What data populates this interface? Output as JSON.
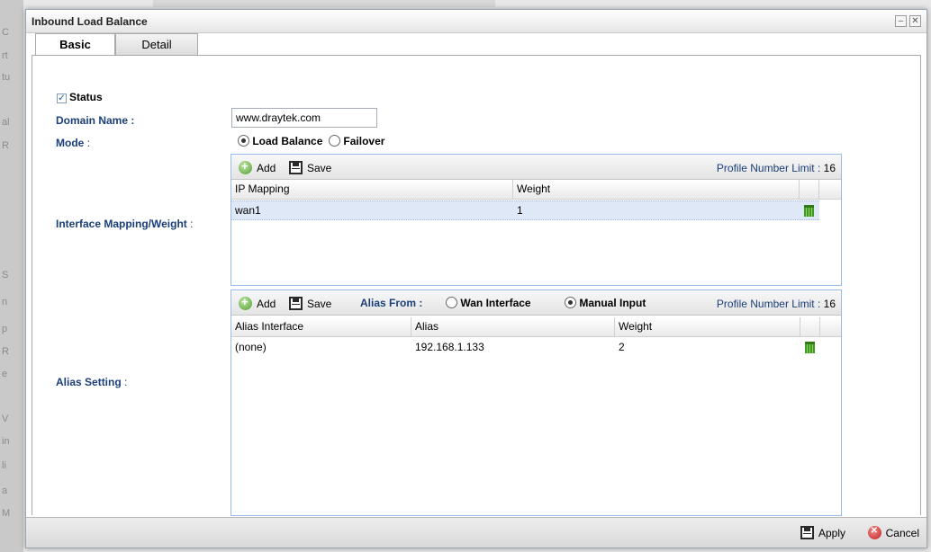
{
  "window": {
    "title": "Inbound Load Balance",
    "minimize_glyph": "–",
    "close_glyph": "✕"
  },
  "tabs": [
    {
      "label": "Basic",
      "active": true
    },
    {
      "label": "Detail",
      "active": false
    }
  ],
  "form": {
    "status": {
      "label": "Status",
      "checked": true
    },
    "domain_name": {
      "label": "Domain Name :",
      "value": "www.draytek.com"
    },
    "mode": {
      "label": "Mode",
      "colon": ":",
      "options": [
        {
          "label": "Load Balance",
          "selected": true
        },
        {
          "label": "Failover",
          "selected": false
        }
      ]
    },
    "interface_mapping": {
      "label": "Interface Mapping/Weight",
      "colon": ":",
      "toolbar": {
        "add": "Add",
        "save": "Save",
        "limit_label": "Profile Number Limit :",
        "limit_value": "16"
      },
      "columns": [
        "IP Mapping",
        "Weight"
      ],
      "rows": [
        {
          "ip_mapping": "wan1",
          "weight": "1",
          "selected": true
        }
      ]
    },
    "alias_setting": {
      "label": "Alias Setting",
      "colon": ":",
      "toolbar": {
        "add": "Add",
        "save": "Save",
        "alias_from_label": "Alias From :",
        "alias_from_options": [
          {
            "label": "Wan Interface",
            "selected": false
          },
          {
            "label": "Manual Input",
            "selected": true
          }
        ],
        "limit_label": "Profile Number Limit :",
        "limit_value": "16"
      },
      "columns": [
        "Alias Interface",
        "Alias",
        "Weight"
      ],
      "rows": [
        {
          "alias_interface": "(none)",
          "alias": "192.168.1.133",
          "weight": "2"
        }
      ]
    }
  },
  "footer": {
    "apply": "Apply",
    "cancel": "Cancel"
  },
  "icons": {
    "add": "add-icon",
    "save": "save-icon",
    "delete": "trash-icon",
    "apply": "save-icon",
    "cancel": "cancel-icon"
  },
  "colors": {
    "label_blue": "#1a3f7a",
    "selected_row": "#dfe8f6",
    "grid_border": "#99bbe8"
  }
}
